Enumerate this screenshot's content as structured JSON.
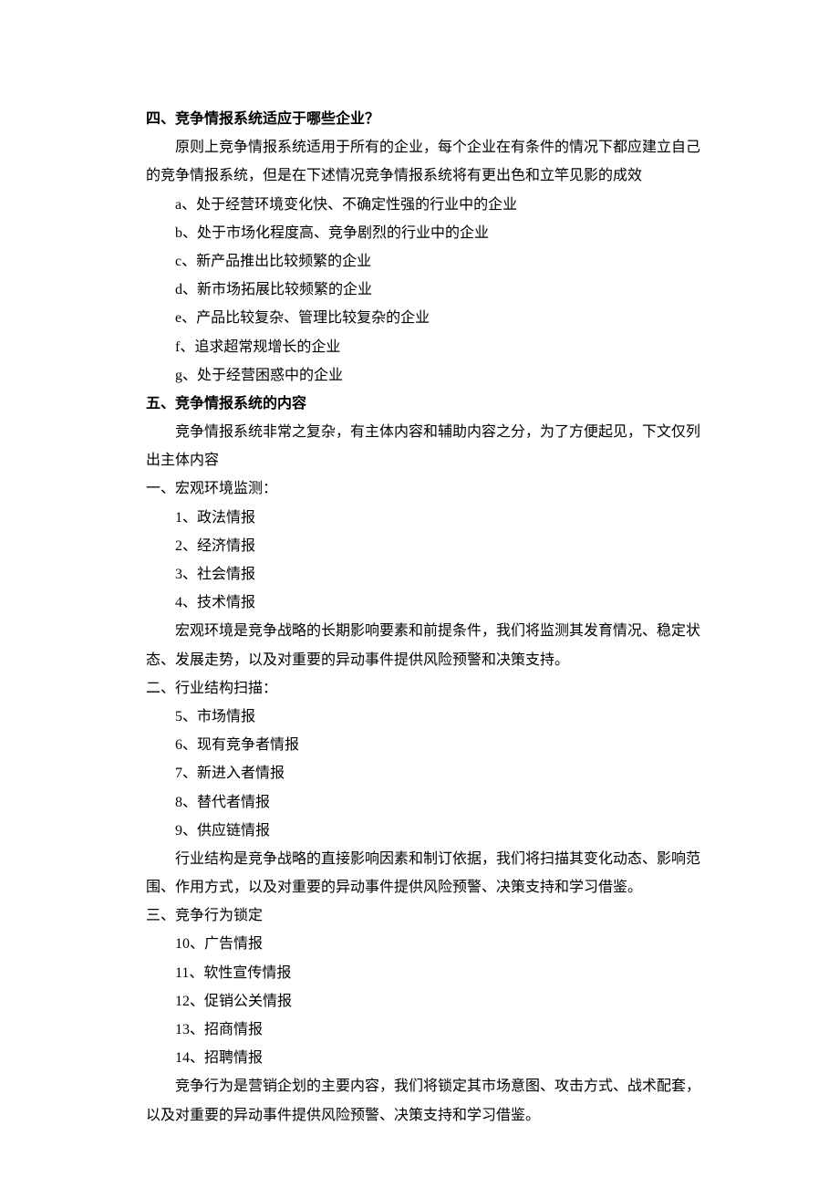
{
  "s4": {
    "heading": "四、竞争情报系统适应于哪些企业？",
    "intro": "原则上竞争情报系统适用于所有的企业，每个企业在有条件的情况下都应建立自己的竞争情报系统，但是在下述情况竞争情报系统将有更出色和立竿见影的成效",
    "items": [
      {
        "letter": "a、",
        "text": "处于经营环境变化快、不确定性强的行业中的企业"
      },
      {
        "letter": "b、",
        "text": "处于市场化程度高、竞争剧烈的行业中的企业"
      },
      {
        "letter": "c、",
        "text": "新产品推出比较频繁的企业"
      },
      {
        "letter": "d、",
        "text": "新市场拓展比较频繁的企业"
      },
      {
        "letter": "e、",
        "text": "产品比较复杂、管理比较复杂的企业"
      },
      {
        "letter": "f、",
        "text": "追求超常规增长的企业"
      },
      {
        "letter": "g、",
        "text": "处于经营困惑中的企业"
      }
    ]
  },
  "s5": {
    "heading": "五、竞争情报系统的内容",
    "intro": "竞争情报系统非常之复杂，有主体内容和辅助内容之分，为了方便起见，下文仅列出主体内容",
    "sub1": {
      "title": "一、宏观环境监测：",
      "items": [
        "1、政法情报",
        "2、经济情报",
        "3、社会情报",
        "4、技术情报"
      ],
      "desc": "宏观环境是竞争战略的长期影响要素和前提条件，我们将监测其发育情况、稳定状态、发展走势，以及对重要的异动事件提供风险预警和决策支持。"
    },
    "sub2": {
      "title": "二、行业结构扫描：",
      "items": [
        "5、市场情报",
        "6、现有竞争者情报",
        "7、新进入者情报",
        "8、替代者情报",
        "9、供应链情报"
      ],
      "desc": "行业结构是竞争战略的直接影响因素和制订依据，我们将扫描其变化动态、影响范围、作用方式，以及对重要的异动事件提供风险预警、决策支持和学习借鉴。"
    },
    "sub3": {
      "title": "三、竞争行为锁定",
      "items": [
        "10、广告情报",
        "11、软性宣传情报",
        "12、促销公关情报",
        "13、招商情报",
        "14、招聘情报"
      ],
      "desc": "竞争行为是营销企划的主要内容，我们将锁定其市场意图、攻击方式、战术配套，以及对重要的异动事件提供风险预警、决策支持和学习借鉴。"
    }
  }
}
